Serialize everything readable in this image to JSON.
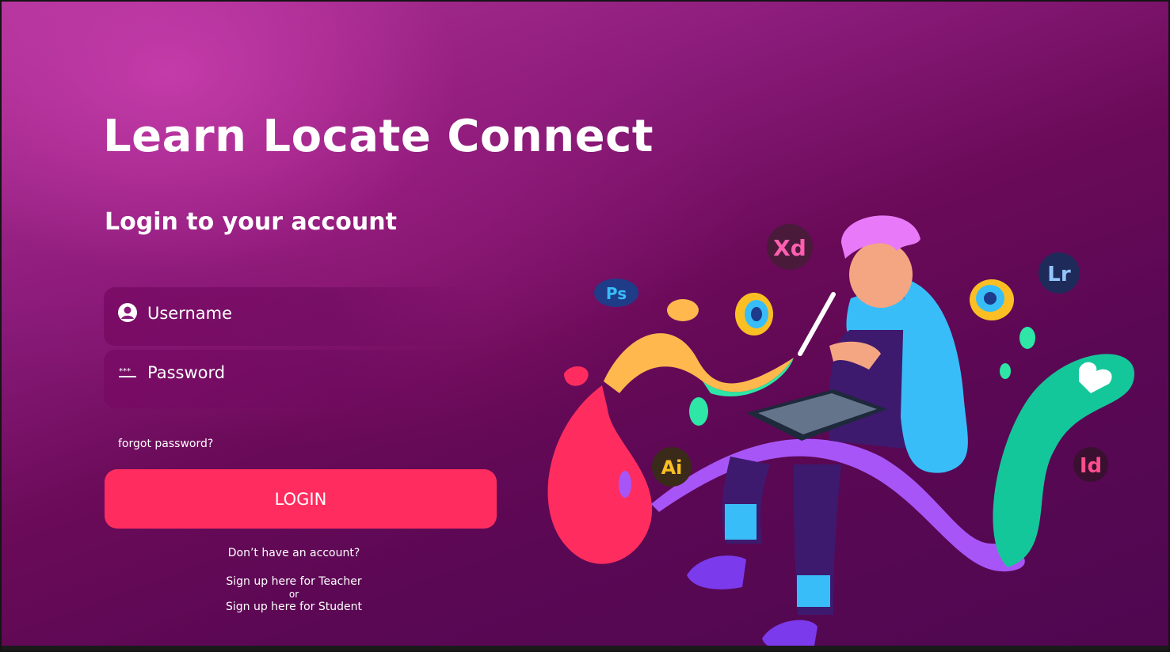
{
  "header": {
    "title": "Learn Locate Connect",
    "subtitle": "Login to your account"
  },
  "form": {
    "username_placeholder": "Username",
    "password_placeholder": "Password",
    "username_icon": "user-circle-icon",
    "password_icon": "password-dots-icon",
    "forgot_label": "forgot password?",
    "login_label": "LOGIN"
  },
  "signup": {
    "question": "Don’t have an account?",
    "teacher_link": "Sign up here for Teacher",
    "or": "or",
    "student_link": "Sign up here for Student"
  },
  "illustration": {
    "badges": [
      "Xd",
      "Ps",
      "Lr",
      "Ai",
      "Id"
    ]
  },
  "colors": {
    "accent": "#ff2d5f",
    "background_dark": "#5a0854",
    "background_light": "#b2349a"
  }
}
